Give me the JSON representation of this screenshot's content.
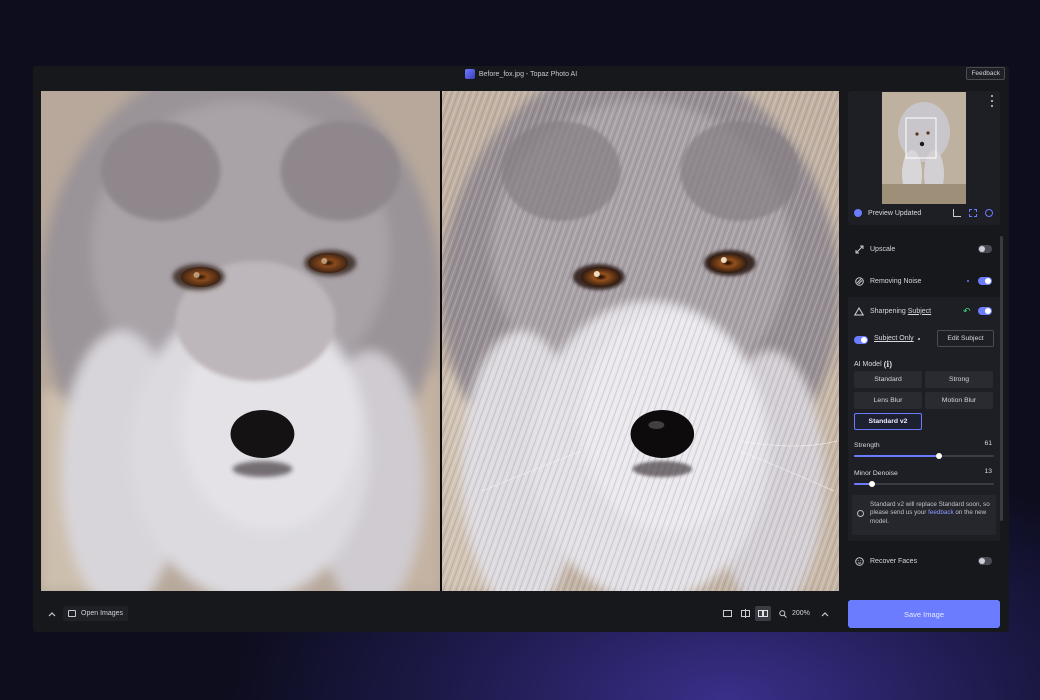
{
  "window": {
    "title": "Before_fox.jpg - Topaz Photo AI",
    "feedback_label": "Feedback"
  },
  "bottombar": {
    "open_images_label": "Open Images",
    "zoom_label": "200%"
  },
  "preview": {
    "status_label": "Preview Updated"
  },
  "sidebar": {
    "upscale_label": "Upscale",
    "noise_label": "Removing Noise",
    "sharpen_label_prefix": "Sharpening ",
    "sharpen_label_link": "Subject",
    "subject_only_label": "Subject Only",
    "edit_subject_label": "Edit Subject",
    "ai_model_label": "AI Model",
    "models": [
      "Standard",
      "Strong",
      "Lens Blur",
      "Motion Blur",
      "Standard v2"
    ],
    "selected_model": "Standard v2",
    "strength": {
      "label": "Strength",
      "value": 61
    },
    "denoise": {
      "label": "Minor Denoise",
      "value": 13
    },
    "notice_text": "Standard v2 will replace Standard soon, so please send us your",
    "notice_link": "feedback",
    "notice_tail": " on the new model.",
    "recover_faces_label": "Recover Faces",
    "toggles": {
      "upscale": false,
      "noise": true,
      "sharpen": true,
      "subject_only": true,
      "recover_faces": false
    }
  },
  "save_label": "Save Image",
  "colors": {
    "accent": "#6b7cff",
    "panel": "#1e1f24",
    "background": "#17181c"
  }
}
